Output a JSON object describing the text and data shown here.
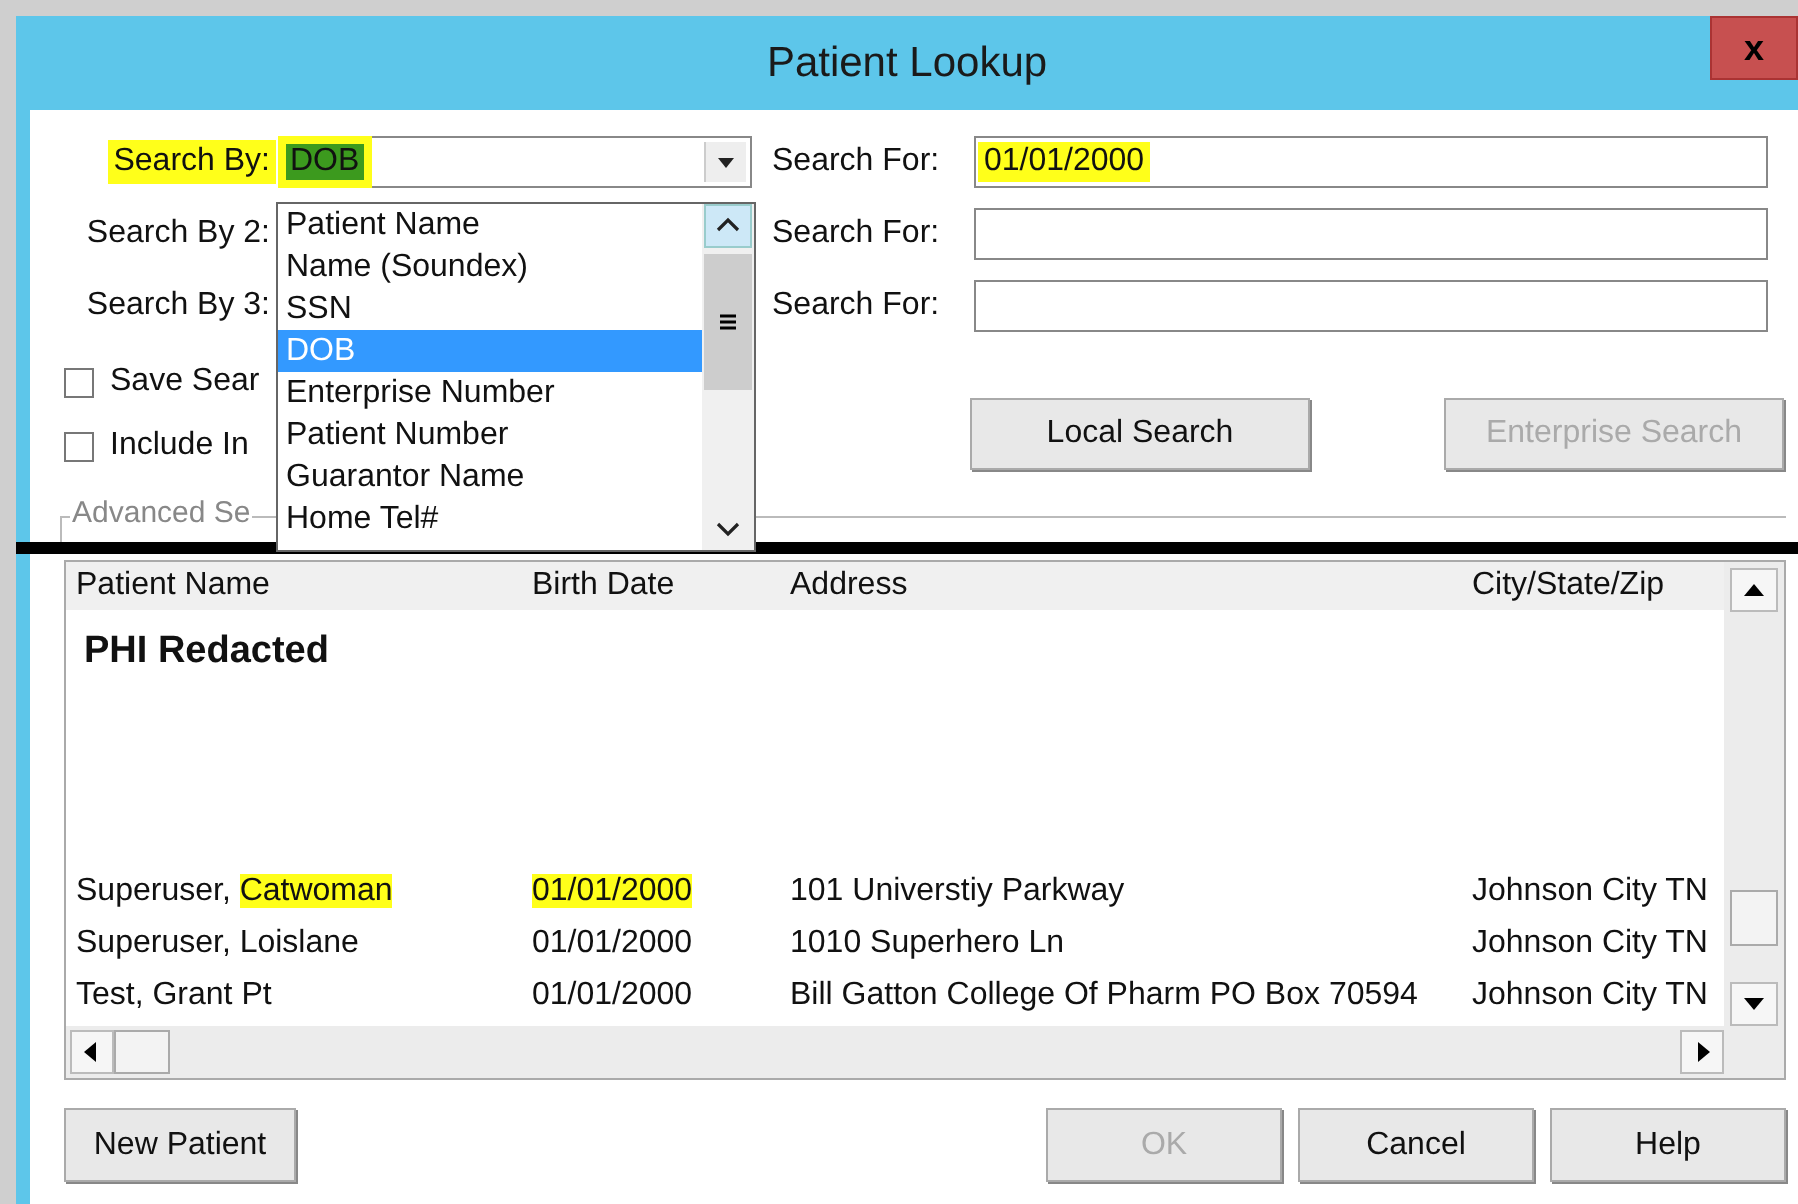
{
  "window": {
    "title": "Patient Lookup",
    "close": "x"
  },
  "criteria": [
    {
      "label": "Search By:",
      "highlighted": true,
      "value": "DOB",
      "for_label": "Search For:",
      "for_value": "01/01/2000"
    },
    {
      "label": "Search By 2:",
      "highlighted": false,
      "for_label": "Search For:"
    },
    {
      "label": "Search By 3:",
      "highlighted": false,
      "for_label": "Search For:"
    }
  ],
  "dropdown": {
    "options": [
      {
        "label": "Patient Name",
        "selected": false
      },
      {
        "label": "Name (Soundex)",
        "selected": false
      },
      {
        "label": "SSN",
        "selected": false
      },
      {
        "label": "DOB",
        "selected": true
      },
      {
        "label": "Enterprise Number",
        "selected": false
      },
      {
        "label": "Patient Number",
        "selected": false
      },
      {
        "label": "Guarantor Name",
        "selected": false
      },
      {
        "label": "Home Tel#",
        "selected": false
      }
    ]
  },
  "options": [
    {
      "label": "Save Sear",
      "checked": false
    },
    {
      "label": "Include In",
      "checked": false
    }
  ],
  "search_buttons": [
    {
      "label": "Local Search",
      "disabled": false
    },
    {
      "label": "Enterprise Search",
      "disabled": true
    }
  ],
  "advanced": {
    "legend": "Advanced Se"
  },
  "results": {
    "columns": [
      "Patient Name",
      "Birth Date",
      "Address",
      "City/State/Zip"
    ],
    "notice": "PHI Redacted",
    "rows": [
      {
        "name_last": "Superuser,",
        "name_first": "Catwoman",
        "highlighted": true,
        "birth_date": "01/01/2000",
        "address": "101 Universtiy Parkway",
        "city": "Johnson City TN"
      },
      {
        "name_last": "Superuser,",
        "name_first": "Loislane",
        "highlighted": false,
        "birth_date": "01/01/2000",
        "address": "1010 Superhero Ln",
        "city": "Johnson City TN"
      },
      {
        "name_last": "Test,",
        "name_first": "Grant Pt",
        "highlighted": false,
        "birth_date": "01/01/2000",
        "address": "Bill Gatton College Of Pharm PO Box 70594",
        "city": "Johnson City TN"
      }
    ]
  },
  "footer_buttons": [
    {
      "label": "New Patient",
      "disabled": false
    },
    {
      "label": "OK",
      "disabled": true
    },
    {
      "label": "Cancel",
      "disabled": false
    },
    {
      "label": "Help",
      "disabled": false
    }
  ]
}
